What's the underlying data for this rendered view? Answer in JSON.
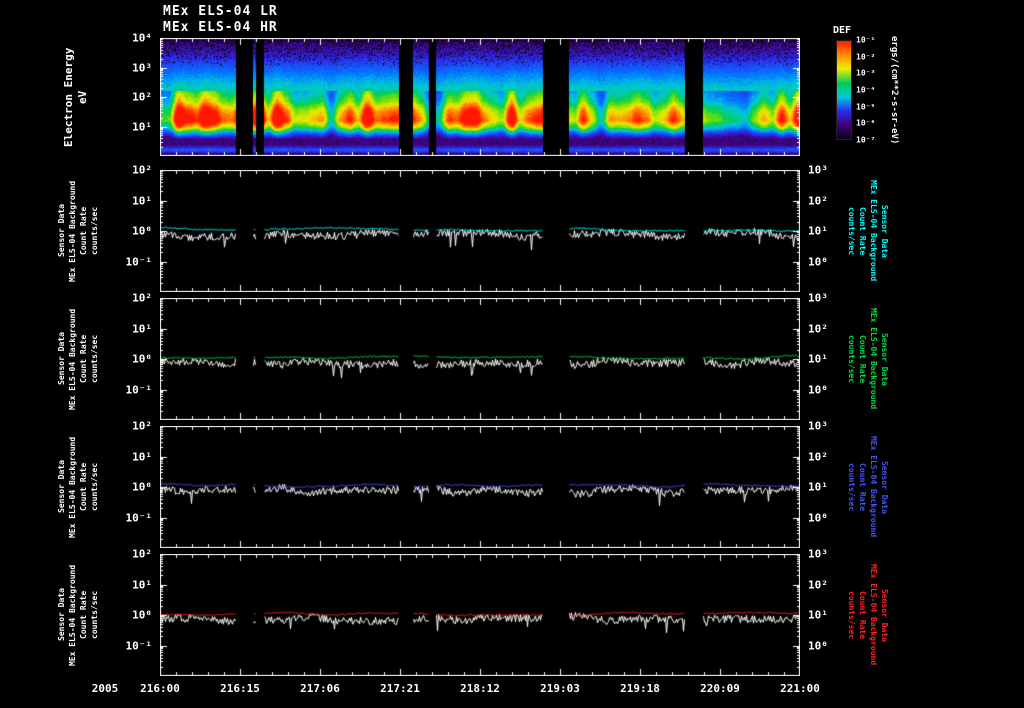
{
  "page": {
    "title_lr": "MEx ELS-04 LR",
    "title_hr": "MEx ELS-04 HR"
  },
  "xaxis": {
    "year": "2005",
    "tick_labels": [
      "216:00",
      "216:15",
      "217:06",
      "217:21",
      "218:12",
      "219:03",
      "219:18",
      "220:09",
      "221:00"
    ]
  },
  "chart_data": [
    {
      "type": "heatmap",
      "name": "electron-energy-spectrogram",
      "title": "MEx ELS-04 LR / MEx ELS-04 HR",
      "ylabel": "Electron Energy",
      "ylabel_units": "eV",
      "y_ticks": [
        "10⁴",
        "10³",
        "10²",
        "10¹"
      ],
      "y_range_log10_ev": [
        0,
        4
      ],
      "x_ticks": [
        "216:00",
        "216:15",
        "217:06",
        "217:21",
        "218:12",
        "219:03",
        "219:18",
        "220:09",
        "221:00"
      ],
      "colorbar": {
        "title": "DEF",
        "units": "ergs/(cm**2-s-sr-eV)",
        "ticks": [
          "10⁻¹",
          "10⁻²",
          "10⁻³",
          "10⁻⁴",
          "10⁻⁵",
          "10⁻⁶",
          "10⁻⁷"
        ],
        "range_log10": [
          -7,
          -1
        ],
        "colors_top_to_bottom": [
          "#ff1900",
          "#ff8c00",
          "#f0eb00",
          "#00cd55",
          "#00c8d7",
          "#2c2ceb",
          "#400078",
          "#080018"
        ]
      },
      "data_gaps_frac": [
        [
          0.118,
          0.144
        ],
        [
          0.15,
          0.162
        ],
        [
          0.372,
          0.394
        ],
        [
          0.42,
          0.43
        ],
        [
          0.598,
          0.638
        ],
        [
          0.819,
          0.847
        ]
      ],
      "flux_structure": {
        "peak_flux_band_ev": [
          10,
          100
        ],
        "peak_band_color": "yellow-red, DEF near 10⁻²",
        "mid_band_100_1000_ev": "green to blue, DEF 10⁻⁴ to 10⁻⁵",
        "above_1kev": "dark blue-purple with black speckle, DEF near 10⁻⁷",
        "below_5ev": "dark band with thin bright line at bottom edge"
      }
    },
    {
      "type": "line",
      "name": "count-rate-panel-1",
      "left_label_lines": [
        "Sensor Data",
        "MEx ELS-04 Background",
        "Count Rate",
        "counts/sec"
      ],
      "right_label_lines": [
        "Sensor Data",
        "MEx ELS-04 Background",
        "Count Rate",
        "counts/sec"
      ],
      "right_label_color": "#00ffff",
      "left_ticks": [
        "10²",
        "10¹",
        "10⁰",
        "10⁻¹"
      ],
      "right_ticks": [
        "10³",
        "10²",
        "10¹",
        "10⁰"
      ],
      "ylim_log10": [
        -2,
        2
      ],
      "series": [
        {
          "name": "background count rate",
          "color": "#00ffff",
          "mean_counts_per_sec": 1.15,
          "style": "smooth"
        },
        {
          "name": "count rate",
          "color": "#ffffff",
          "mean_counts_per_sec": 0.75,
          "range_counts_per_sec": [
            0.3,
            1.6
          ],
          "style": "noisy"
        }
      ],
      "data_gaps_frac": [
        [
          0.118,
          0.144
        ],
        [
          0.15,
          0.162
        ],
        [
          0.372,
          0.394
        ],
        [
          0.42,
          0.43
        ],
        [
          0.598,
          0.638
        ],
        [
          0.819,
          0.847
        ]
      ]
    },
    {
      "type": "line",
      "name": "count-rate-panel-2",
      "left_label_lines": [
        "Sensor Data",
        "MEx ELS-04 Background",
        "Count Rate",
        "counts/sec"
      ],
      "right_label_lines": [
        "Sensor Data",
        "MEx ELS-04 Background",
        "Count Rate",
        "counts/sec"
      ],
      "right_label_color": "#00dd44",
      "left_ticks": [
        "10²",
        "10¹",
        "10⁰",
        "10⁻¹"
      ],
      "right_ticks": [
        "10³",
        "10²",
        "10¹",
        "10⁰"
      ],
      "ylim_log10": [
        -2,
        2
      ],
      "series": [
        {
          "name": "background count rate",
          "color": "#00dd44",
          "mean_counts_per_sec": 1.15,
          "style": "smooth"
        },
        {
          "name": "count rate",
          "color": "#ffffff",
          "mean_counts_per_sec": 0.75,
          "range_counts_per_sec": [
            0.3,
            1.6
          ],
          "style": "noisy"
        }
      ],
      "data_gaps_frac": [
        [
          0.118,
          0.144
        ],
        [
          0.15,
          0.162
        ],
        [
          0.372,
          0.394
        ],
        [
          0.42,
          0.43
        ],
        [
          0.598,
          0.638
        ],
        [
          0.819,
          0.847
        ]
      ]
    },
    {
      "type": "line",
      "name": "count-rate-panel-3",
      "left_label_lines": [
        "Sensor Data",
        "MEx ELS-04 Background",
        "Count Rate",
        "counts/sec"
      ],
      "right_label_lines": [
        "Sensor Data",
        "MEx ELS-04 Background",
        "Count Rate",
        "counts/sec"
      ],
      "right_label_color": "#4455ee",
      "left_ticks": [
        "10²",
        "10¹",
        "10⁰",
        "10⁻¹"
      ],
      "right_ticks": [
        "10³",
        "10²",
        "10¹",
        "10⁰"
      ],
      "ylim_log10": [
        -2,
        2
      ],
      "series": [
        {
          "name": "background count rate",
          "color": "#4455ee",
          "mean_counts_per_sec": 1.1,
          "style": "smooth"
        },
        {
          "name": "count rate",
          "color": "#ffffff",
          "mean_counts_per_sec": 0.75,
          "range_counts_per_sec": [
            0.3,
            1.6
          ],
          "style": "noisy"
        }
      ],
      "data_gaps_frac": [
        [
          0.118,
          0.144
        ],
        [
          0.15,
          0.162
        ],
        [
          0.372,
          0.394
        ],
        [
          0.42,
          0.43
        ],
        [
          0.598,
          0.638
        ],
        [
          0.819,
          0.847
        ]
      ]
    },
    {
      "type": "line",
      "name": "count-rate-panel-4",
      "left_label_lines": [
        "Sensor Data",
        "MEx ELS-04 Background",
        "Count Rate",
        "counts/sec"
      ],
      "right_label_lines": [
        "Sensor Data",
        "MEx ELS-04 Background",
        "Count Rate",
        "counts/sec"
      ],
      "right_label_color": "#ff2222",
      "left_ticks": [
        "10²",
        "10¹",
        "10⁰",
        "10⁻¹"
      ],
      "right_ticks": [
        "10³",
        "10²",
        "10¹",
        "10⁰"
      ],
      "ylim_log10": [
        -2,
        2
      ],
      "series": [
        {
          "name": "background count rate",
          "color": "#ff2222",
          "mean_counts_per_sec": 1.2,
          "style": "smooth"
        },
        {
          "name": "count rate",
          "color": "#ffffff",
          "mean_counts_per_sec": 0.75,
          "range_counts_per_sec": [
            0.3,
            1.6
          ],
          "style": "noisy"
        }
      ],
      "data_gaps_frac": [
        [
          0.118,
          0.144
        ],
        [
          0.15,
          0.162
        ],
        [
          0.372,
          0.394
        ],
        [
          0.42,
          0.43
        ],
        [
          0.598,
          0.638
        ],
        [
          0.819,
          0.847
        ]
      ]
    }
  ]
}
